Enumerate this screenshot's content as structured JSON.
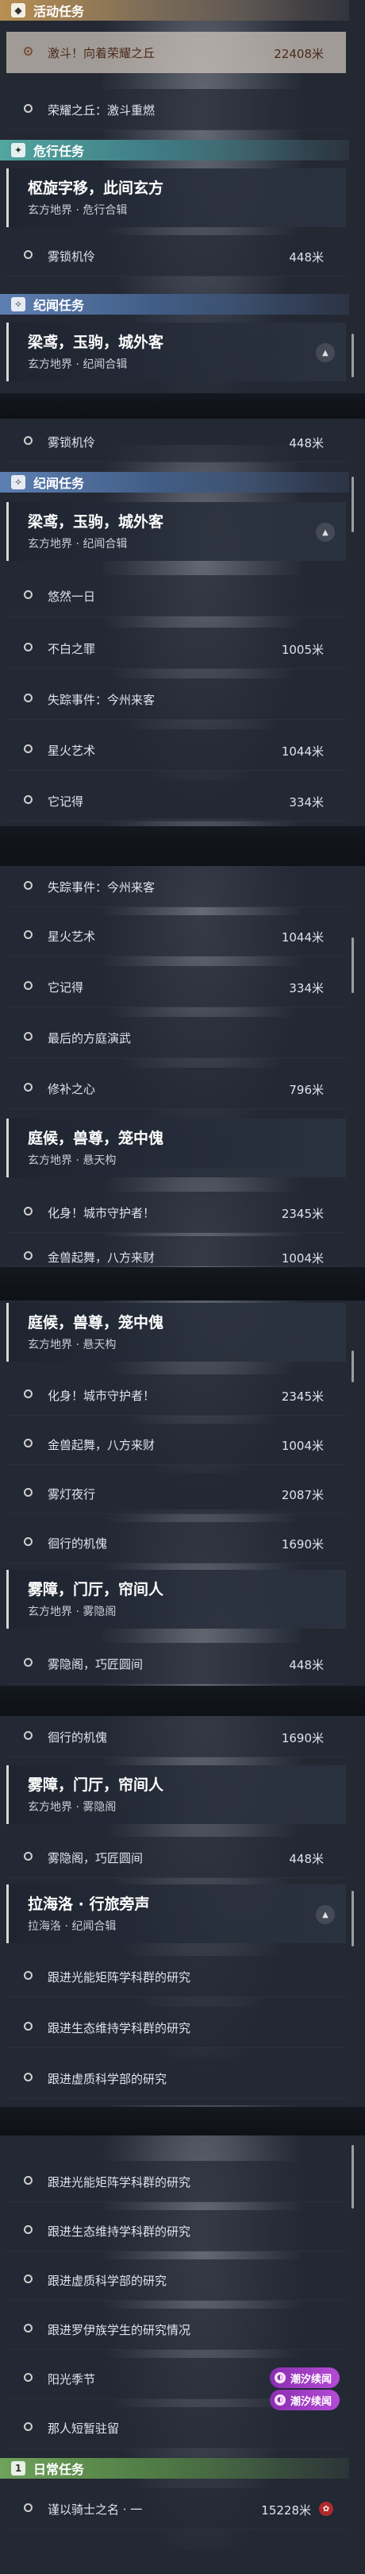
{
  "sections": {
    "active_tasks": "活动任务",
    "danger_tasks": "危行任务",
    "world_tasks": "纪闻任务",
    "daily_tasks": "日常任务"
  },
  "quests": {
    "trial": {
      "name": "激斗！向着荣耀之丘",
      "dist": "22408米"
    },
    "glory": {
      "name": "荣耀之丘：激斗重燃"
    },
    "mist_lock": {
      "name": "雾锁机伶",
      "dist": "448米"
    },
    "endless_day": {
      "name": "悠然一日"
    },
    "immortal": {
      "name": "不白之罪",
      "dist": "1005米"
    },
    "missing": {
      "name": "失踪事件：今州来客"
    },
    "starfire": {
      "name": "星火艺术",
      "dist": "1044米"
    },
    "remember": {
      "name": "它记得",
      "dist": "334米"
    },
    "last_square": {
      "name": "最后的方庭演武"
    },
    "repair_heart": {
      "name": "修补之心",
      "dist": "796米"
    },
    "incarnate": {
      "name": "化身！城市守护者！",
      "dist": "2345米"
    },
    "golden": {
      "name": "金兽起舞，八方来财",
      "dist": "1004米"
    },
    "lantern": {
      "name": "雾灯夜行",
      "dist": "2087米"
    },
    "puppet": {
      "name": "徊行的机傀",
      "dist": "1690米"
    },
    "mist_pavilion": {
      "name": "雾隐阁，巧匠圆间",
      "dist": "448米"
    },
    "research_1": {
      "name": "跟进光能矩阵学科群的研究"
    },
    "research_2": {
      "name": "跟进生态维持学科群的研究"
    },
    "research_3": {
      "name": "跟进虚质科学部的研究"
    },
    "research_4": {
      "name": "跟进罗伊族学生的研究情况"
    },
    "sun_season": {
      "name": "阳光季节"
    },
    "small_sky": {
      "name": "那人短暂驻留"
    },
    "knight": {
      "name": "谨以骑士之名 · 一",
      "dist": "15228米"
    }
  },
  "groups": {
    "pivot": {
      "title": "枢旋字移，此间玄方",
      "sub": "玄方地界 · 危行合辑"
    },
    "liang": {
      "title": "梁鸢，玉驹，城外客",
      "sub": "玄方地界 · 纪闻合辑"
    },
    "courtyard": {
      "title": "庭候，兽尊，笼中傀",
      "sub": "玄方地界 · 悬天构"
    },
    "mist_gate": {
      "title": "雾障，门厅，帘间人",
      "sub": "玄方地界 · 雾隐阁"
    },
    "lahai": {
      "title": "拉海洛 · 行旅旁声",
      "sub": "拉海洛 · 纪闻合辑"
    }
  },
  "badge_label": "潮汐续闻",
  "badge_icon": "tide-icon",
  "colors": {
    "active_header": "#b88f52",
    "danger_header": "#52a6a0",
    "world_header": "#5d7fb2",
    "daily_header": "#6fa25a",
    "badge": "#a03dcb"
  }
}
